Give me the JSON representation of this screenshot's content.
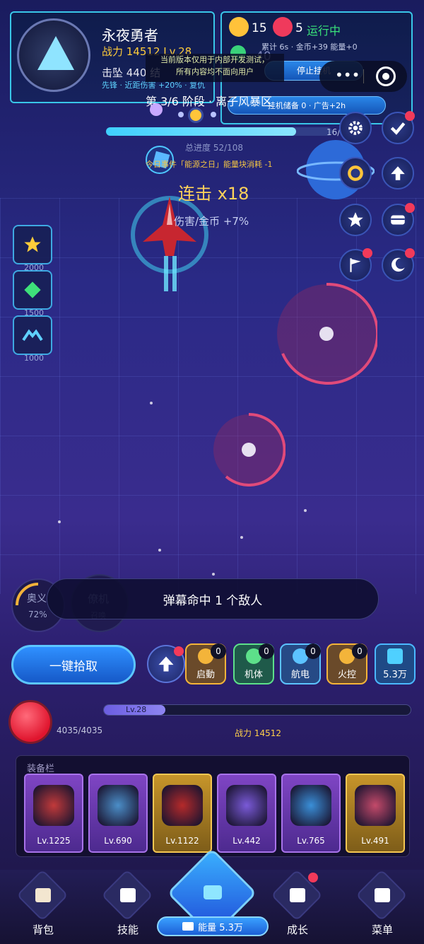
{
  "player": {
    "name": "永夜勇者",
    "power_line": "战力 14512 Lv.28",
    "kills_line": "击坠 440  结",
    "tags_line": "先锋 · 近距伤害 +20% · 复仇"
  },
  "resources": {
    "gold_amount": "15",
    "gem_amount": "5",
    "status": "运行中",
    "earning_line": "累计 6s · 金币+39 能量+0",
    "stop_idle_label": "停止挂机",
    "idle_reserve_label": "挂机储备 0 · 广告+2h",
    "overlay_number": "40"
  },
  "notice": {
    "line1": "当前版本仅用于内部开发测试，",
    "line2": "所有内容均不面向用户"
  },
  "stage": {
    "label": "第 3/6 阶段 · 离子风暴区",
    "count": "16/",
    "progress": 0.84,
    "total_progress": "总进度 52/108",
    "event_line": "今日事件「能源之日」能量块消耗 -1",
    "combo": "连击 x18",
    "damage_text": "伤害/金币 +7%"
  },
  "left_skills": [
    {
      "icon": "star-icon",
      "cost": "2000"
    },
    {
      "icon": "diamond-icon",
      "cost": "1500"
    },
    {
      "icon": "chevron-wing-icon",
      "cost": "1000"
    }
  ],
  "right_buttons": [
    {
      "icon": "gear-icon",
      "badge": false
    },
    {
      "icon": "check-icon",
      "badge": true
    },
    {
      "icon": "ring-icon",
      "badge": false
    },
    {
      "icon": "arrow-up-icon",
      "badge": false
    },
    {
      "icon": "star-icon",
      "badge": false
    },
    {
      "icon": "card-icon",
      "badge": true
    },
    {
      "icon": "flag-icon",
      "badge": true
    },
    {
      "icon": "moon-icon",
      "badge": true
    }
  ],
  "hud": {
    "toast": "弹幕命中 1 个敌人",
    "ult_label": "奥义",
    "ult_pct": "72%",
    "summon_label": "僚机",
    "summon_sub": "召唤",
    "pickup_label": "一键拾取",
    "res_cards": [
      {
        "label": "启動",
        "count": "0",
        "color": "#f3b43a",
        "theme": "#6a4a2a"
      },
      {
        "label": "机体",
        "count": "0",
        "color": "#5de08a",
        "theme": "#1f5a4a"
      },
      {
        "label": "航电",
        "count": "0",
        "color": "#5cc3ff",
        "theme": "#264a86"
      },
      {
        "label": "火控",
        "count": "0",
        "color": "#f3b43a",
        "theme": "#6a4a2a"
      }
    ],
    "energy_card": "5.3万",
    "hp": "4035/4035",
    "lv": "Lv.28",
    "lv_progress": 0.2,
    "power": "战力 14512"
  },
  "equipment": {
    "title": "装备栏",
    "items": [
      {
        "level": "Lv.1225",
        "rarity": "purple",
        "art": "#c23a3a"
      },
      {
        "level": "Lv.690",
        "rarity": "purple",
        "art": "#4b8ec8"
      },
      {
        "level": "Lv.1122",
        "rarity": "gold",
        "art": "#b52a2a"
      },
      {
        "level": "Lv.442",
        "rarity": "purple",
        "art": "#7a5ad8"
      },
      {
        "level": "Lv.765",
        "rarity": "purple",
        "art": "#3a8fd8"
      },
      {
        "level": "Lv.491",
        "rarity": "gold",
        "art": "#c44a6a"
      }
    ]
  },
  "nav": {
    "items": [
      {
        "label": "背包",
        "icon": "bag-icon"
      },
      {
        "label": "技能",
        "icon": "book-icon"
      },
      {
        "label": "成长",
        "icon": "arrow-up-icon"
      },
      {
        "label": "菜单",
        "icon": "map-icon"
      }
    ],
    "energy": "能量 5.3万"
  },
  "colors": {
    "accent": "#39c6e8",
    "gold": "#ffcc3a",
    "running": "#39e27a",
    "badge": "#f23a5a"
  }
}
